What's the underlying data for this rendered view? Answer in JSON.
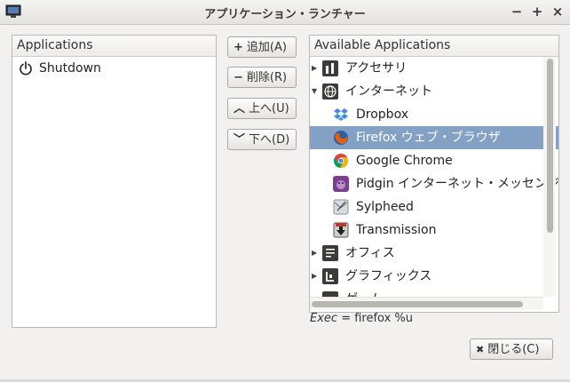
{
  "window": {
    "title": "アプリケーション・ランチャー",
    "controls": {
      "minimize": "−",
      "maximize": "+",
      "close": "×"
    }
  },
  "left_panel": {
    "header": "Applications",
    "items": [
      {
        "label": "Shutdown",
        "icon": "power-icon"
      }
    ]
  },
  "buttons": {
    "add": {
      "symbol": "+",
      "label": "追加(A)"
    },
    "remove": {
      "symbol": "−",
      "label": "削除(R)"
    },
    "up": {
      "symbol": "︿",
      "label": "上へ(U)"
    },
    "down": {
      "symbol": "﹀",
      "label": "下へ(D)"
    },
    "close": {
      "symbol": "✖",
      "label": "閉じる(C)"
    }
  },
  "right_panel": {
    "header": "Available Applications",
    "items": [
      {
        "label": "アクセサリ",
        "type": "category",
        "expanded": false,
        "icon": "accessories-icon"
      },
      {
        "label": "インターネット",
        "type": "category",
        "expanded": true,
        "icon": "globe-icon"
      },
      {
        "label": "Dropbox",
        "type": "app",
        "icon": "dropbox-icon"
      },
      {
        "label": "Firefox ウェブ・ブラウザ",
        "type": "app",
        "icon": "firefox-icon",
        "selected": true
      },
      {
        "label": "Google Chrome",
        "type": "app",
        "icon": "chrome-icon"
      },
      {
        "label": "Pidgin インターネット・メッセンジャー",
        "type": "app",
        "icon": "pidgin-icon"
      },
      {
        "label": "Sylpheed",
        "type": "app",
        "icon": "sylpheed-icon"
      },
      {
        "label": "Transmission",
        "type": "app",
        "icon": "transmission-icon"
      },
      {
        "label": "オフィス",
        "type": "category",
        "expanded": false,
        "icon": "office-icon"
      },
      {
        "label": "グラフィックス",
        "type": "category",
        "expanded": false,
        "icon": "graphics-icon"
      },
      {
        "label": "ゲーム",
        "type": "category",
        "expanded": false,
        "icon": "games-icon"
      }
    ]
  },
  "exec": {
    "key": "Exec",
    "separator": " = ",
    "value": "firefox %u"
  },
  "colors": {
    "selection": "#82a1c4",
    "firefox_orange": "#e66000",
    "dropbox_blue": "#3d8ee0"
  }
}
